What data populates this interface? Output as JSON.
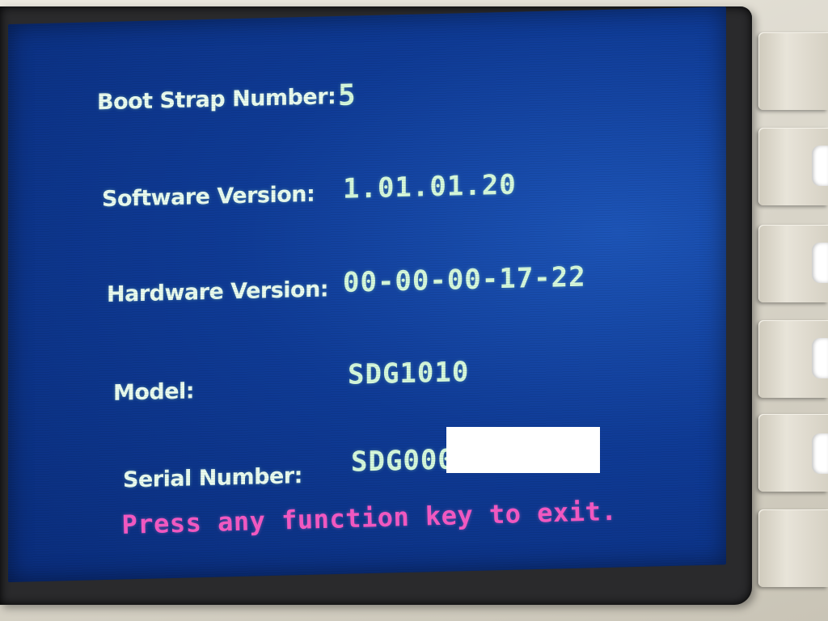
{
  "info_screen": {
    "boot_strap": {
      "label": "Boot Strap Number:",
      "value": "5"
    },
    "software_version": {
      "label": "Software Version:",
      "value": "1.01.01.20"
    },
    "hardware_version": {
      "label": "Hardware Version:",
      "value": "00-00-00-17-22"
    },
    "model": {
      "label": "Model:",
      "value": "SDG1010"
    },
    "serial_number": {
      "label": "Serial Number:",
      "value": "SDG000"
    },
    "exit_prompt": "Press any function key to exit."
  },
  "colors": {
    "screen_bg": "#0f3b96",
    "label_text": "#eafcef",
    "value_text": "#d6f9dc",
    "prompt_text": "#f058c0"
  },
  "side_buttons": [
    {
      "icon": "blank-softkey"
    },
    {
      "icon": "blank-softkey"
    },
    {
      "icon": "blank-softkey"
    },
    {
      "icon": "blank-softkey"
    },
    {
      "icon": "blank-softkey"
    },
    {
      "icon": "blank-softkey"
    }
  ]
}
